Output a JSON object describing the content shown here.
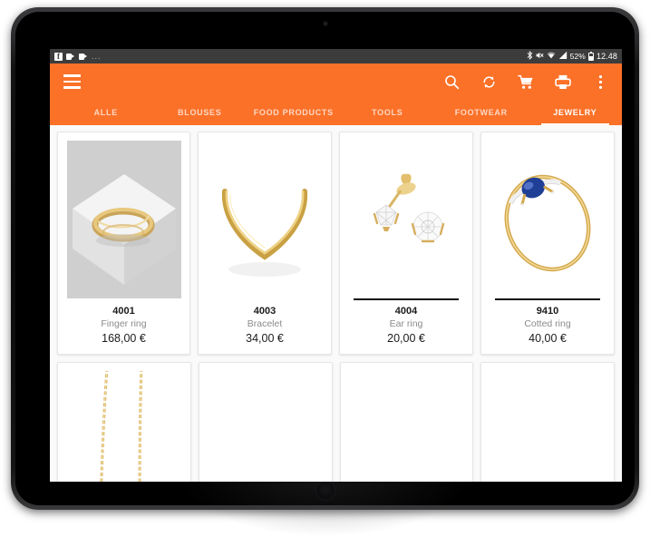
{
  "status_bar": {
    "notification_icons": [
      "facebook-icon",
      "chat-bubble-icon",
      "chat-bubble-icon"
    ],
    "overflow_dots": "...",
    "bluetooth_icon": "✳",
    "mute_icon": "🔇",
    "wifi_icon": "wifi-icon",
    "signal_icon": "signal-icon",
    "battery_percent": "52%",
    "clock": "12.48"
  },
  "app_bar": {
    "menu_label": "menu",
    "actions": [
      {
        "name": "search-button",
        "icon": "search-icon"
      },
      {
        "name": "sync-button",
        "icon": "sync-icon"
      },
      {
        "name": "cart-button",
        "icon": "shopping-cart-icon"
      },
      {
        "name": "print-button",
        "icon": "printer-icon"
      },
      {
        "name": "overflow-button",
        "icon": "more-vertical-icon"
      }
    ],
    "accent_color": "#fb7128"
  },
  "tabs": [
    {
      "label": "ALLE",
      "active": false
    },
    {
      "label": "BLOUSES",
      "active": false
    },
    {
      "label": "FOOD PRODUCTS",
      "active": false
    },
    {
      "label": "TOOLS",
      "active": false
    },
    {
      "label": "FOOTWEAR",
      "active": false
    },
    {
      "label": "JEWELRY",
      "active": true
    }
  ],
  "products": [
    {
      "sku": "4001",
      "name": "Finger ring",
      "price": "168,00 €",
      "image": "gold-filigree-ring-on-pedestal",
      "divider": false
    },
    {
      "sku": "4003",
      "name": "Bracelet",
      "price": "34,00 €",
      "image": "gold-v-shaped-bangle",
      "divider": false
    },
    {
      "sku": "4004",
      "name": "Ear ring",
      "price": "20,00 €",
      "image": "diamond-stud-earrings",
      "divider": true
    },
    {
      "sku": "9410",
      "name": "Cotted ring",
      "price": "40,00 €",
      "image": "gold-ring-with-blue-sapphire",
      "divider": true
    }
  ],
  "products_row2": [
    {
      "sku": "",
      "name": "",
      "price": "",
      "image": "gold-chain-necklace",
      "divider": false
    }
  ]
}
